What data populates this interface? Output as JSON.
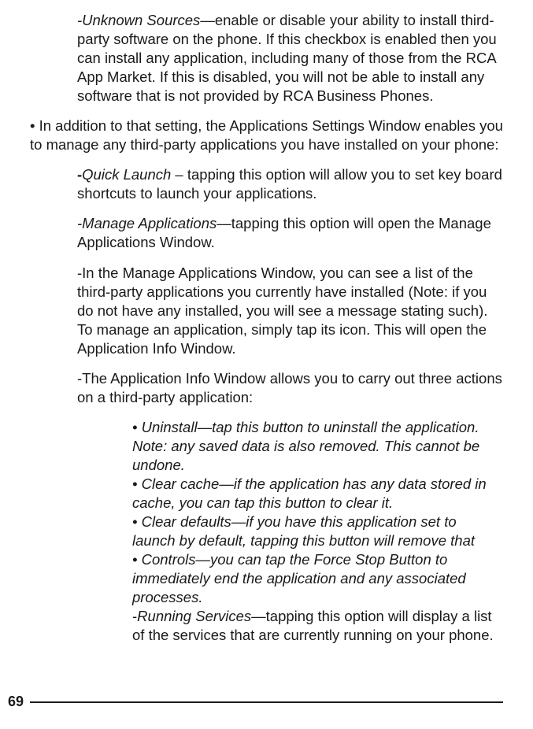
{
  "page_number": "69",
  "p1": {
    "prefix": "-",
    "title": "Unknown Sources",
    "text": "—enable or disable your ability to install third-party software on the phone. If this checkbox is enabled then you can install any application, including many of those from the RCA App Market. If this is disabled, you will not be able to install any software that is not provided by RCA Busi­ness Phones."
  },
  "p2": "• In addition to that setting, the Applications Settings Window enables you to manage any third-party applications you have installed on your phone:",
  "p3": {
    "prefix": "-",
    "title": "Quick Launch",
    "text": " – tapping this option will allow you to set key board shortcuts to launch your applications."
  },
  "p4": {
    "prefix": "-",
    "title": "Manage Applications",
    "text": "—tapping this option will open the Man­age Applications Window."
  },
  "p5": "-In the Manage Applications Window, you can see a list of the third-party applications you currently have installed (Note: if you do not have any installed, you will see a message stating such). To manage an application, simply tap its icon. This will open the Application Info Window.",
  "p6": "-The Application Info Window allows you to carry out three actions on a third-party application:",
  "d1": "• Uninstall—tap this button to uninstall the applica­tion. Note: any saved data is also removed. This cannot be undone.",
  "d2": "• Clear cache—if the application has any data stored in cache, you can tap this button to clear it.",
  "d3": "• Clear defaults—if you have this application set to launch by default, tapping this button will remove that",
  "d4": "• Controls—you can tap the Force Stop Button to immediately end the application and any associated processes.",
  "d5": {
    "prefix": "-",
    "title": "Running Services",
    "text": "—tapping this option will display a list of the services that are currently running on your phone."
  }
}
